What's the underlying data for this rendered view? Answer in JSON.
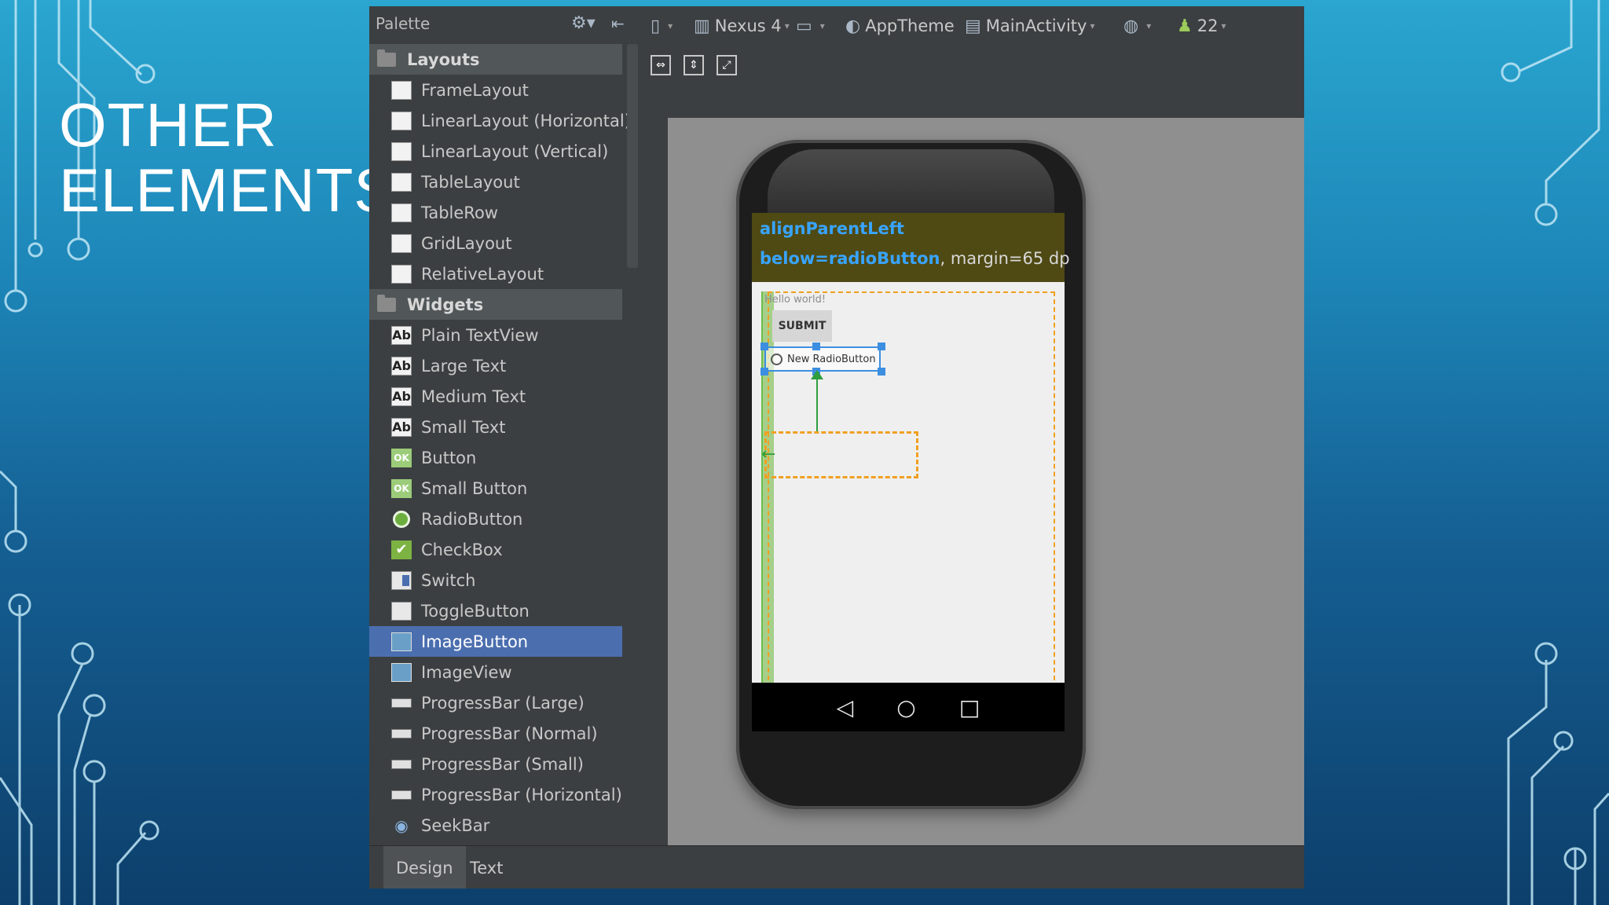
{
  "slide": {
    "title_line1": "OTHER",
    "title_line2": "ELEMENTS"
  },
  "palette": {
    "title": "Palette",
    "categories": [
      {
        "label": "Layouts",
        "items": [
          {
            "label": "FrameLayout",
            "icon": "frame-layout-icon"
          },
          {
            "label": "LinearLayout (Horizontal)",
            "icon": "linear-layout-horizontal-icon"
          },
          {
            "label": "LinearLayout (Vertical)",
            "icon": "linear-layout-vertical-icon"
          },
          {
            "label": "TableLayout",
            "icon": "table-layout-icon"
          },
          {
            "label": "TableRow",
            "icon": "table-row-icon"
          },
          {
            "label": "GridLayout",
            "icon": "grid-layout-icon"
          },
          {
            "label": "RelativeLayout",
            "icon": "relative-layout-icon"
          }
        ]
      },
      {
        "label": "Widgets",
        "items": [
          {
            "label": "Plain TextView",
            "icon": "text-icon",
            "glyph": "Ab"
          },
          {
            "label": "Large Text",
            "icon": "text-icon",
            "glyph": "Ab"
          },
          {
            "label": "Medium Text",
            "icon": "text-icon",
            "glyph": "Ab"
          },
          {
            "label": "Small Text",
            "icon": "text-icon",
            "glyph": "Ab"
          },
          {
            "label": "Button",
            "icon": "button-icon",
            "glyph": "OK"
          },
          {
            "label": "Small Button",
            "icon": "button-icon",
            "glyph": "OK"
          },
          {
            "label": "RadioButton",
            "icon": "radio-button-icon"
          },
          {
            "label": "CheckBox",
            "icon": "checkbox-icon",
            "glyph": "✔"
          },
          {
            "label": "Switch",
            "icon": "switch-icon"
          },
          {
            "label": "ToggleButton",
            "icon": "toggle-button-icon"
          },
          {
            "label": "ImageButton",
            "icon": "image-button-icon",
            "selected": true
          },
          {
            "label": "ImageView",
            "icon": "image-view-icon"
          },
          {
            "label": "ProgressBar (Large)",
            "icon": "progress-bar-icon"
          },
          {
            "label": "ProgressBar (Normal)",
            "icon": "progress-bar-icon"
          },
          {
            "label": "ProgressBar (Small)",
            "icon": "progress-bar-icon"
          },
          {
            "label": "ProgressBar (Horizontal)",
            "icon": "progress-bar-icon"
          },
          {
            "label": "SeekBar",
            "icon": "seekbar-icon"
          }
        ]
      }
    ]
  },
  "toolbar": {
    "device": "Nexus 4",
    "theme": "AppTheme",
    "activity": "MainActivity",
    "api_level": "22"
  },
  "preview": {
    "hint_line1": "alignParentLeft",
    "hint_line2_attr": "below=radioButton",
    "hint_line2_rest": ", margin=65 dp",
    "hello_text": "Hello world!",
    "submit_label": "SUBMIT",
    "radio_label": "New RadioButton",
    "nav_back": "◁",
    "nav_home": "○",
    "nav_recent": "□"
  },
  "bottom_tabs": {
    "design": "Design",
    "text": "Text"
  },
  "colors": {
    "selection": "#4b6eaf",
    "ide_bg": "#3c3f41",
    "hint_blue": "#38a4ff",
    "guide_orange": "#f0a020"
  }
}
